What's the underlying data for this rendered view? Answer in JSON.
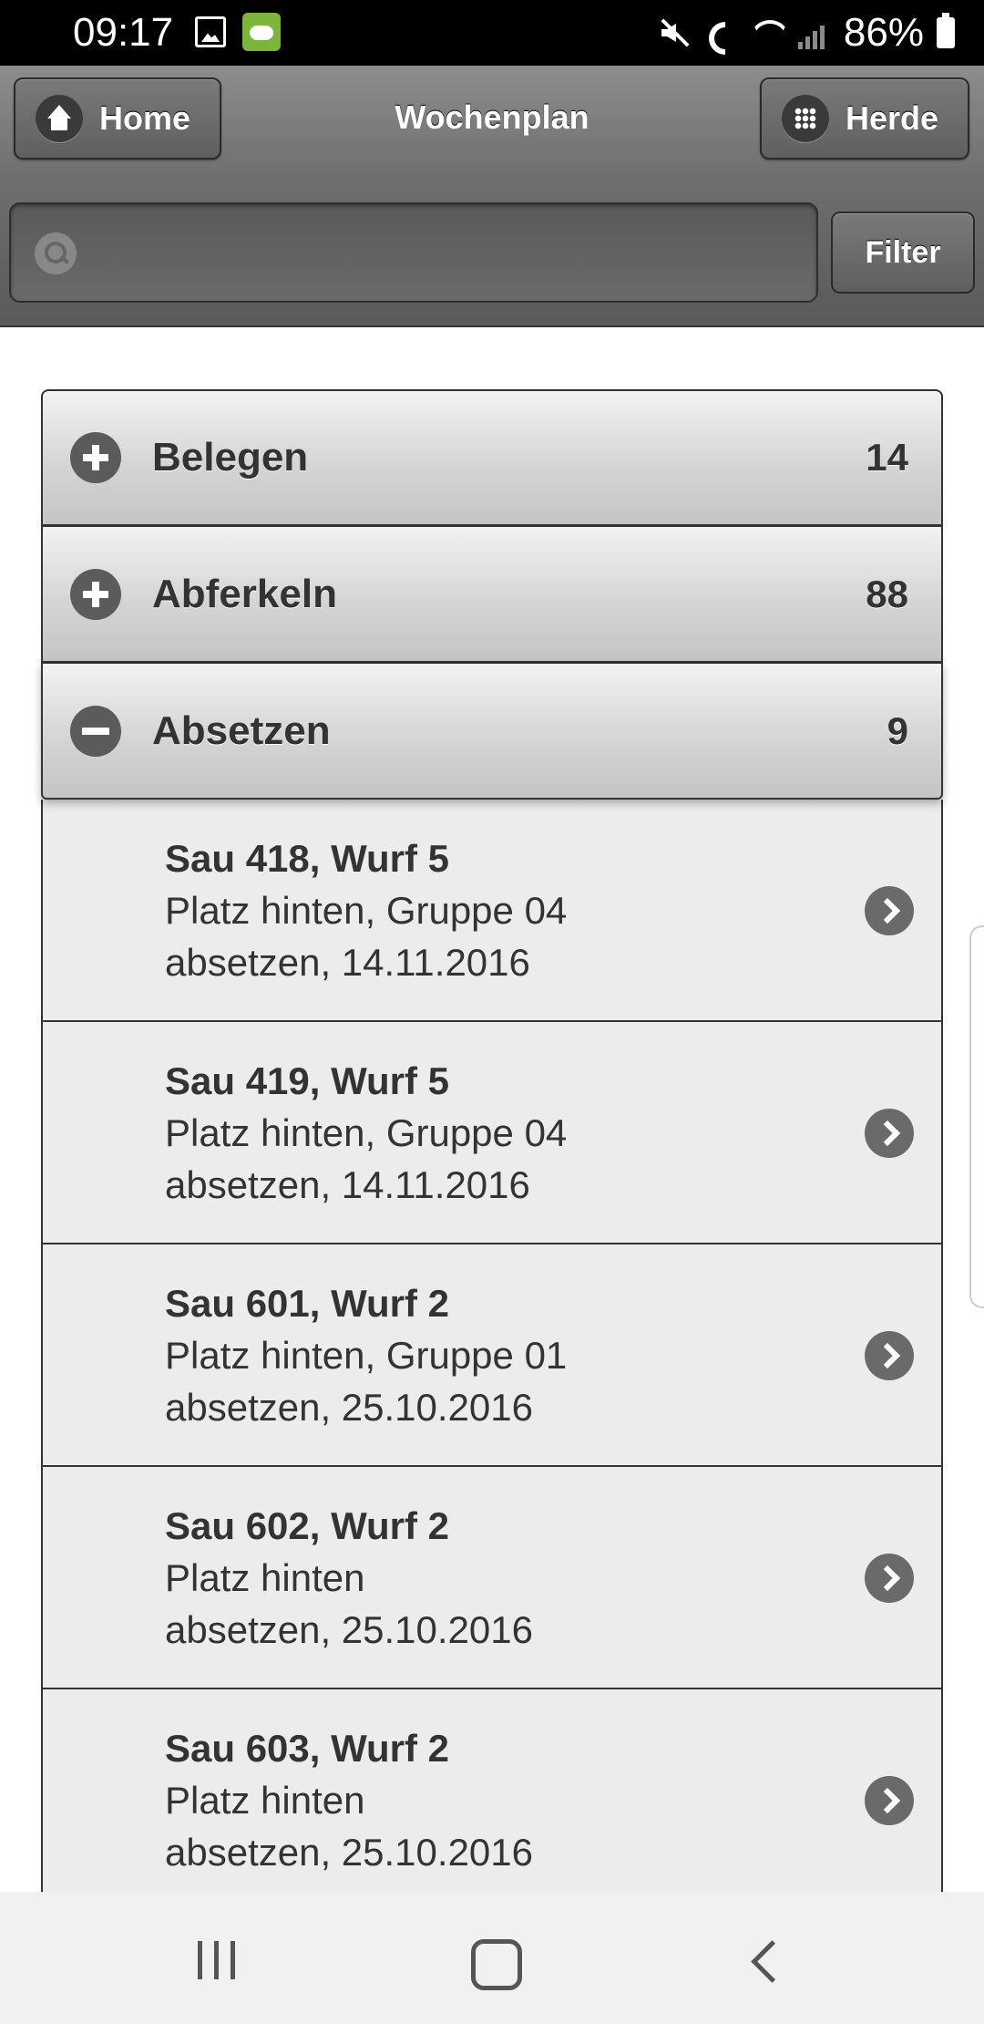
{
  "status_bar": {
    "time": "09:17",
    "battery": "86%",
    "icons": [
      "image-notification-icon",
      "app-notification-icon",
      "mute-icon",
      "wifi-call-icon",
      "wifi-icon",
      "signal-icon",
      "battery-icon"
    ]
  },
  "header": {
    "title": "Wochenplan",
    "home_label": "Home",
    "herde_label": "Herde",
    "filter_label": "Filter",
    "search_placeholder": "",
    "search_value": ""
  },
  "sections": [
    {
      "label": "Belegen",
      "count": "14",
      "state": "collapsed",
      "icon": "plus-icon"
    },
    {
      "label": "Abferkeln",
      "count": "88",
      "state": "collapsed",
      "icon": "plus-icon"
    },
    {
      "label": "Absetzen",
      "count": "9",
      "state": "expanded",
      "icon": "minus-icon"
    }
  ],
  "items": [
    {
      "title": "Sau 418, Wurf 5",
      "line2": "Platz hinten, Gruppe 04",
      "line3": "absetzen, 14.11.2016"
    },
    {
      "title": "Sau 419, Wurf 5",
      "line2": "Platz hinten, Gruppe 04",
      "line3": "absetzen, 14.11.2016"
    },
    {
      "title": "Sau 601, Wurf 2",
      "line2": "Platz hinten, Gruppe 01",
      "line3": "absetzen, 25.10.2016"
    },
    {
      "title": "Sau 602, Wurf 2",
      "line2": "Platz hinten",
      "line3": "absetzen, 25.10.2016"
    },
    {
      "title": "Sau 603, Wurf 2",
      "line2": "Platz hinten",
      "line3": "absetzen, 25.10.2016"
    }
  ],
  "colors": {
    "header": "#6e6e6e",
    "section_bg": "#d5d5d5",
    "item_bg": "#ececec",
    "text": "#333333"
  }
}
